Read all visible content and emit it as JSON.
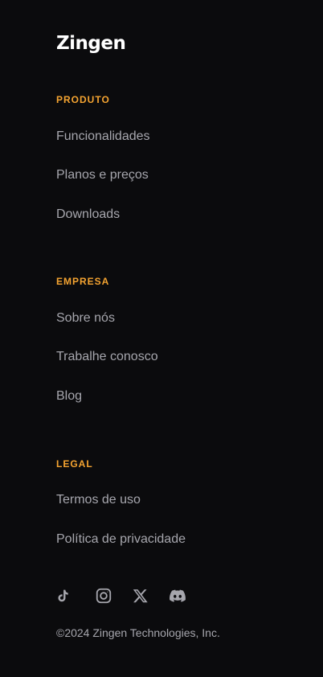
{
  "brand": {
    "logo_text": "Zingen",
    "accent_color": "#f5a431",
    "background_color": "#0b0b0d"
  },
  "sections": [
    {
      "title": "PRODUTO",
      "links": [
        "Funcionalidades",
        "Planos e preços",
        "Downloads"
      ]
    },
    {
      "title": "EMPRESA",
      "links": [
        "Sobre nós",
        "Trabalhe conosco",
        "Blog"
      ]
    },
    {
      "title": "LEGAL",
      "links": [
        "Termos de uso",
        "Política de privacidade"
      ]
    }
  ],
  "social_icons": [
    "tiktok-icon",
    "instagram-icon",
    "x-icon",
    "discord-icon"
  ],
  "copyright": "©2024 Zingen Technologies, Inc."
}
